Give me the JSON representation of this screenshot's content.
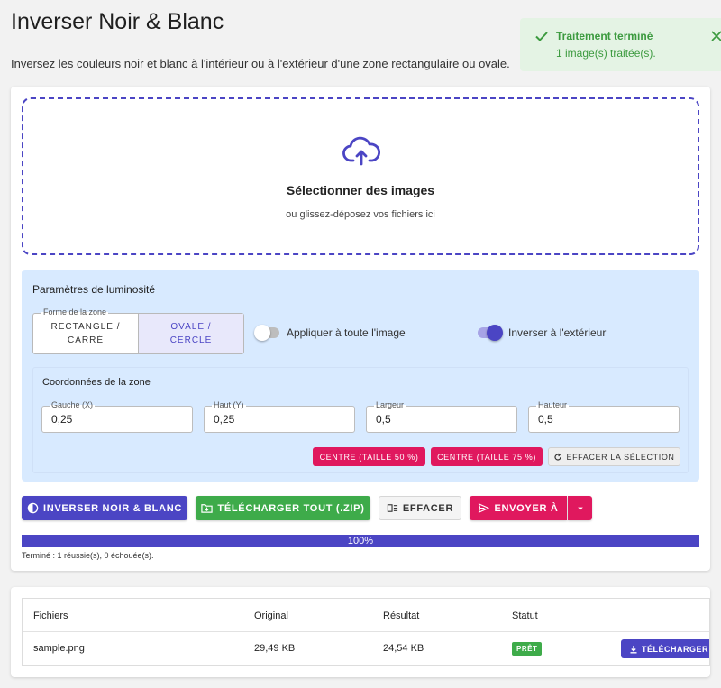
{
  "page": {
    "title": "Inverser Noir & Blanc",
    "description": "Inversez les couleurs noir et blanc à l'intérieur ou à l'extérieur d'une zone rectangulaire ou ovale."
  },
  "toast": {
    "title": "Traitement terminé",
    "message": "1 image(s) traitée(s).",
    "icon": "check-icon",
    "close_icon": "close-icon",
    "color": "#3c9a3f"
  },
  "dropzone": {
    "title": "Sélectionner des images",
    "subtitle": "ou glissez-déposez vos fichiers ici",
    "icon": "cloud-upload-icon"
  },
  "settings": {
    "title": "Paramètres de luminosité",
    "shape": {
      "legend": "Forme de la zone",
      "options": [
        "RECTANGLE / CARRÉ",
        "OVALE / CERCLE"
      ],
      "selected": "OVALE / CERCLE"
    },
    "apply_all": {
      "label": "Appliquer à toute l'image",
      "checked": false
    },
    "invert_outside": {
      "label": "Inverser à l'extérieur",
      "checked": true
    },
    "coords": {
      "title": "Coordonnées de la zone",
      "fields": [
        {
          "label": "Gauche (X)",
          "value": "0,25"
        },
        {
          "label": "Haut (Y)",
          "value": "0,25"
        },
        {
          "label": "Largeur",
          "value": "0,5"
        },
        {
          "label": "Hauteur",
          "value": "0,5"
        }
      ],
      "center_50": "CENTRE (TAILLE 50 %)",
      "center_75": "CENTRE (TAILLE 75 %)",
      "clear_selection": "EFFACER LA SÉLECTION"
    }
  },
  "actions": {
    "invert": "INVERSER NOIR & BLANC",
    "download_all": "TÉLÉCHARGER TOUT (.ZIP)",
    "clear": "EFFACER",
    "send_to": "ENVOYER À"
  },
  "progress": {
    "value": 100,
    "label": "100%"
  },
  "status_text": "Terminé : 1 réussie(s), 0 échouée(s).",
  "table": {
    "columns": [
      "Fichiers",
      "Original",
      "Résultat",
      "Statut"
    ],
    "rows": [
      {
        "file": "sample.png",
        "original": "29,49 KB",
        "result": "24,54 KB",
        "status": "PRÊT",
        "action": "TÉLÉCHARGER"
      }
    ]
  },
  "colors": {
    "accent": "#4b45c4",
    "pink": "#e0185e",
    "green": "#3eab4a",
    "panel": "#d8eaff"
  }
}
